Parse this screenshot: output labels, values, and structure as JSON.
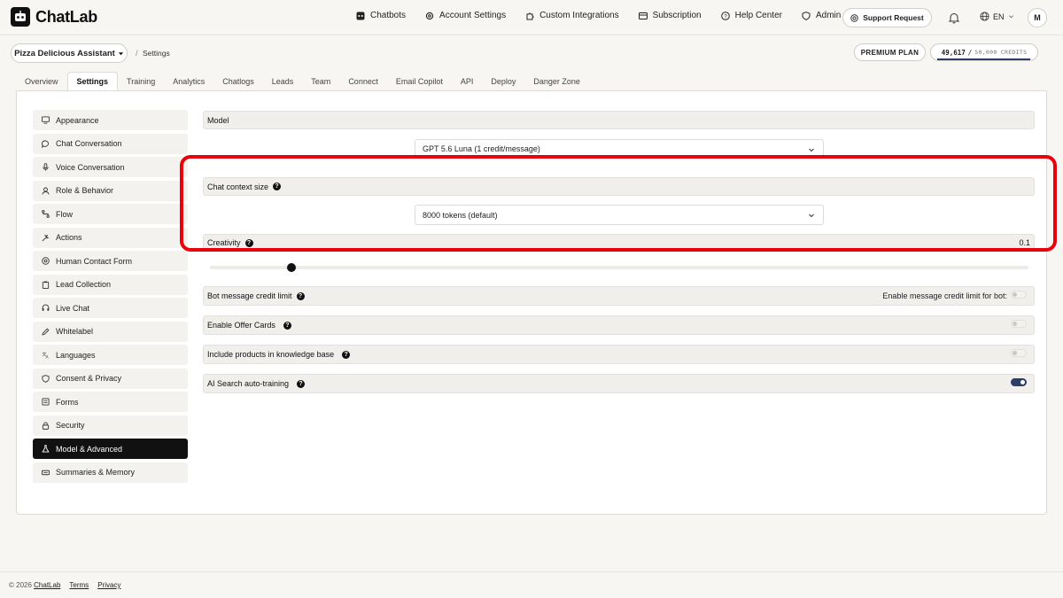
{
  "app": {
    "name": "ChatLab"
  },
  "nav": {
    "links": [
      {
        "label": "Chatbots",
        "icon": "chatbot-icon"
      },
      {
        "label": "Account Settings",
        "icon": "gear-icon"
      },
      {
        "label": "Custom Integrations",
        "icon": "puzzle-icon"
      },
      {
        "label": "Subscription",
        "icon": "card-icon"
      },
      {
        "label": "Help Center",
        "icon": "help-icon"
      },
      {
        "label": "Admin",
        "icon": "shield-icon"
      }
    ],
    "support_label": "Support Request",
    "language": "EN",
    "avatar_initial": "M"
  },
  "subbar": {
    "bot_name": "Pizza Delicious Assistant",
    "breadcrumb_sep": "/",
    "breadcrumb": "Settings",
    "plan": "PREMIUM PLAN",
    "credits_used": "49,617",
    "credits_sep": "/",
    "credits_total": "50,000 CREDITS",
    "credits_fraction": 0.992
  },
  "tabs": [
    {
      "label": "Overview",
      "active": false
    },
    {
      "label": "Settings",
      "active": true
    },
    {
      "label": "Training",
      "active": false
    },
    {
      "label": "Analytics",
      "active": false
    },
    {
      "label": "Chatlogs",
      "active": false
    },
    {
      "label": "Leads",
      "active": false
    },
    {
      "label": "Team",
      "active": false
    },
    {
      "label": "Connect",
      "active": false
    },
    {
      "label": "Email Copilot",
      "active": false
    },
    {
      "label": "API",
      "active": false
    },
    {
      "label": "Deploy",
      "active": false
    },
    {
      "label": "Danger Zone",
      "active": false
    }
  ],
  "sidebar": {
    "items": [
      {
        "label": "Appearance",
        "icon": "monitor-icon",
        "active": false
      },
      {
        "label": "Chat Conversation",
        "icon": "chat-bubble-icon",
        "active": false
      },
      {
        "label": "Voice Conversation",
        "icon": "microphone-icon",
        "active": false
      },
      {
        "label": "Role & Behavior",
        "icon": "user-icon",
        "active": false
      },
      {
        "label": "Flow",
        "icon": "flow-icon",
        "active": false
      },
      {
        "label": "Actions",
        "icon": "actions-icon",
        "active": false
      },
      {
        "label": "Human Contact Form",
        "icon": "at-sign-icon",
        "active": false
      },
      {
        "label": "Lead Collection",
        "icon": "clipboard-icon",
        "active": false
      },
      {
        "label": "Live Chat",
        "icon": "headset-icon",
        "active": false
      },
      {
        "label": "Whitelabel",
        "icon": "pen-icon",
        "active": false
      },
      {
        "label": "Languages",
        "icon": "translate-icon",
        "active": false
      },
      {
        "label": "Consent & Privacy",
        "icon": "shield-icon",
        "active": false
      },
      {
        "label": "Forms",
        "icon": "form-icon",
        "active": false
      },
      {
        "label": "Security",
        "icon": "lock-icon",
        "active": false
      },
      {
        "label": "Model & Advanced",
        "icon": "flask-icon",
        "active": true
      },
      {
        "label": "Summaries & Memory",
        "icon": "keyboard-icon",
        "active": false
      }
    ]
  },
  "settings": {
    "model": {
      "label": "Model",
      "value": "GPT 5.6 Luna (1 credit/message)"
    },
    "context": {
      "label": "Chat context size",
      "value": "8000 tokens (default)"
    },
    "creativity": {
      "label": "Creativity",
      "value": "0.1",
      "fraction": 0.1
    },
    "credit_limit": {
      "label": "Bot message credit limit",
      "toggle_label": "Enable message credit limit for bot:",
      "enabled": false
    },
    "offer_cards": {
      "label": "Enable Offer Cards",
      "enabled": false
    },
    "products_kb": {
      "label": "Include products in knowledge base",
      "enabled": false
    },
    "ai_search": {
      "label": "AI Search auto-training",
      "enabled": true
    }
  },
  "footer": {
    "copyright": "© 2026",
    "brand": "ChatLab",
    "terms": "Terms",
    "privacy": "Privacy"
  },
  "colors": {
    "highlight": "#e8000b",
    "toggle_on": "#2c3e66",
    "active_item": "#111111"
  }
}
